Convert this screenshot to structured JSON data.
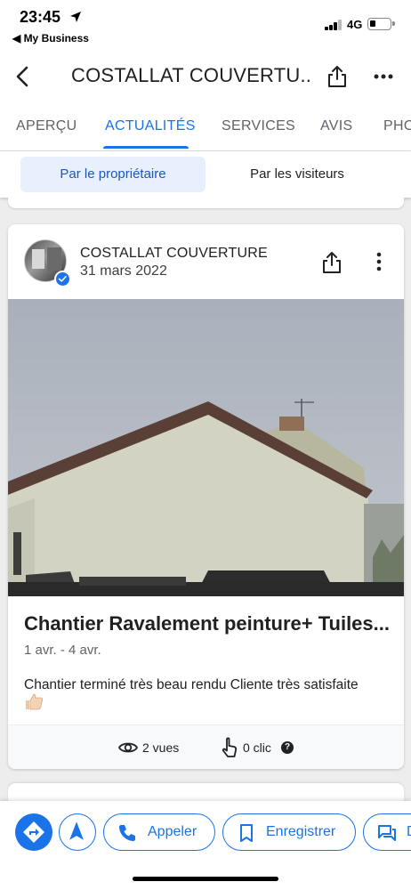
{
  "status_bar": {
    "time": "23:45",
    "back_app": "◀ My Business",
    "network": "4G",
    "battery_level": 0.25
  },
  "header": {
    "title": "COSTALLAT COUVERTU...",
    "back_icon": "chevron-left-icon",
    "share_icon": "share-icon",
    "more_icon": "more-horizontal-icon"
  },
  "tabs": [
    {
      "label": "APERÇU",
      "active": false
    },
    {
      "label": "ACTUALITÉS",
      "active": true
    },
    {
      "label": "SERVICES",
      "active": false
    },
    {
      "label": "AVIS",
      "active": false
    },
    {
      "label": "PHO",
      "active": false
    }
  ],
  "filter": {
    "owner": "Par le propriétaire",
    "visitors": "Par les visiteurs",
    "selected": "owner"
  },
  "post": {
    "business_name": "COSTALLAT COUVERTURE",
    "date": "31 mars 2022",
    "title": "Chantier Ravalement peinture+ Tuiles...",
    "range": "1 avr. - 4 avr.",
    "body": "Chantier terminé très beau rendu Cliente très satisfaite",
    "views": "2 vues",
    "clicks": "0 clic",
    "help": "?"
  },
  "actions": {
    "call": "Appeler",
    "save": "Enregistrer",
    "message": "D"
  },
  "colors": {
    "accent": "#1a73e8",
    "selected_bg": "#e8f0fe"
  }
}
